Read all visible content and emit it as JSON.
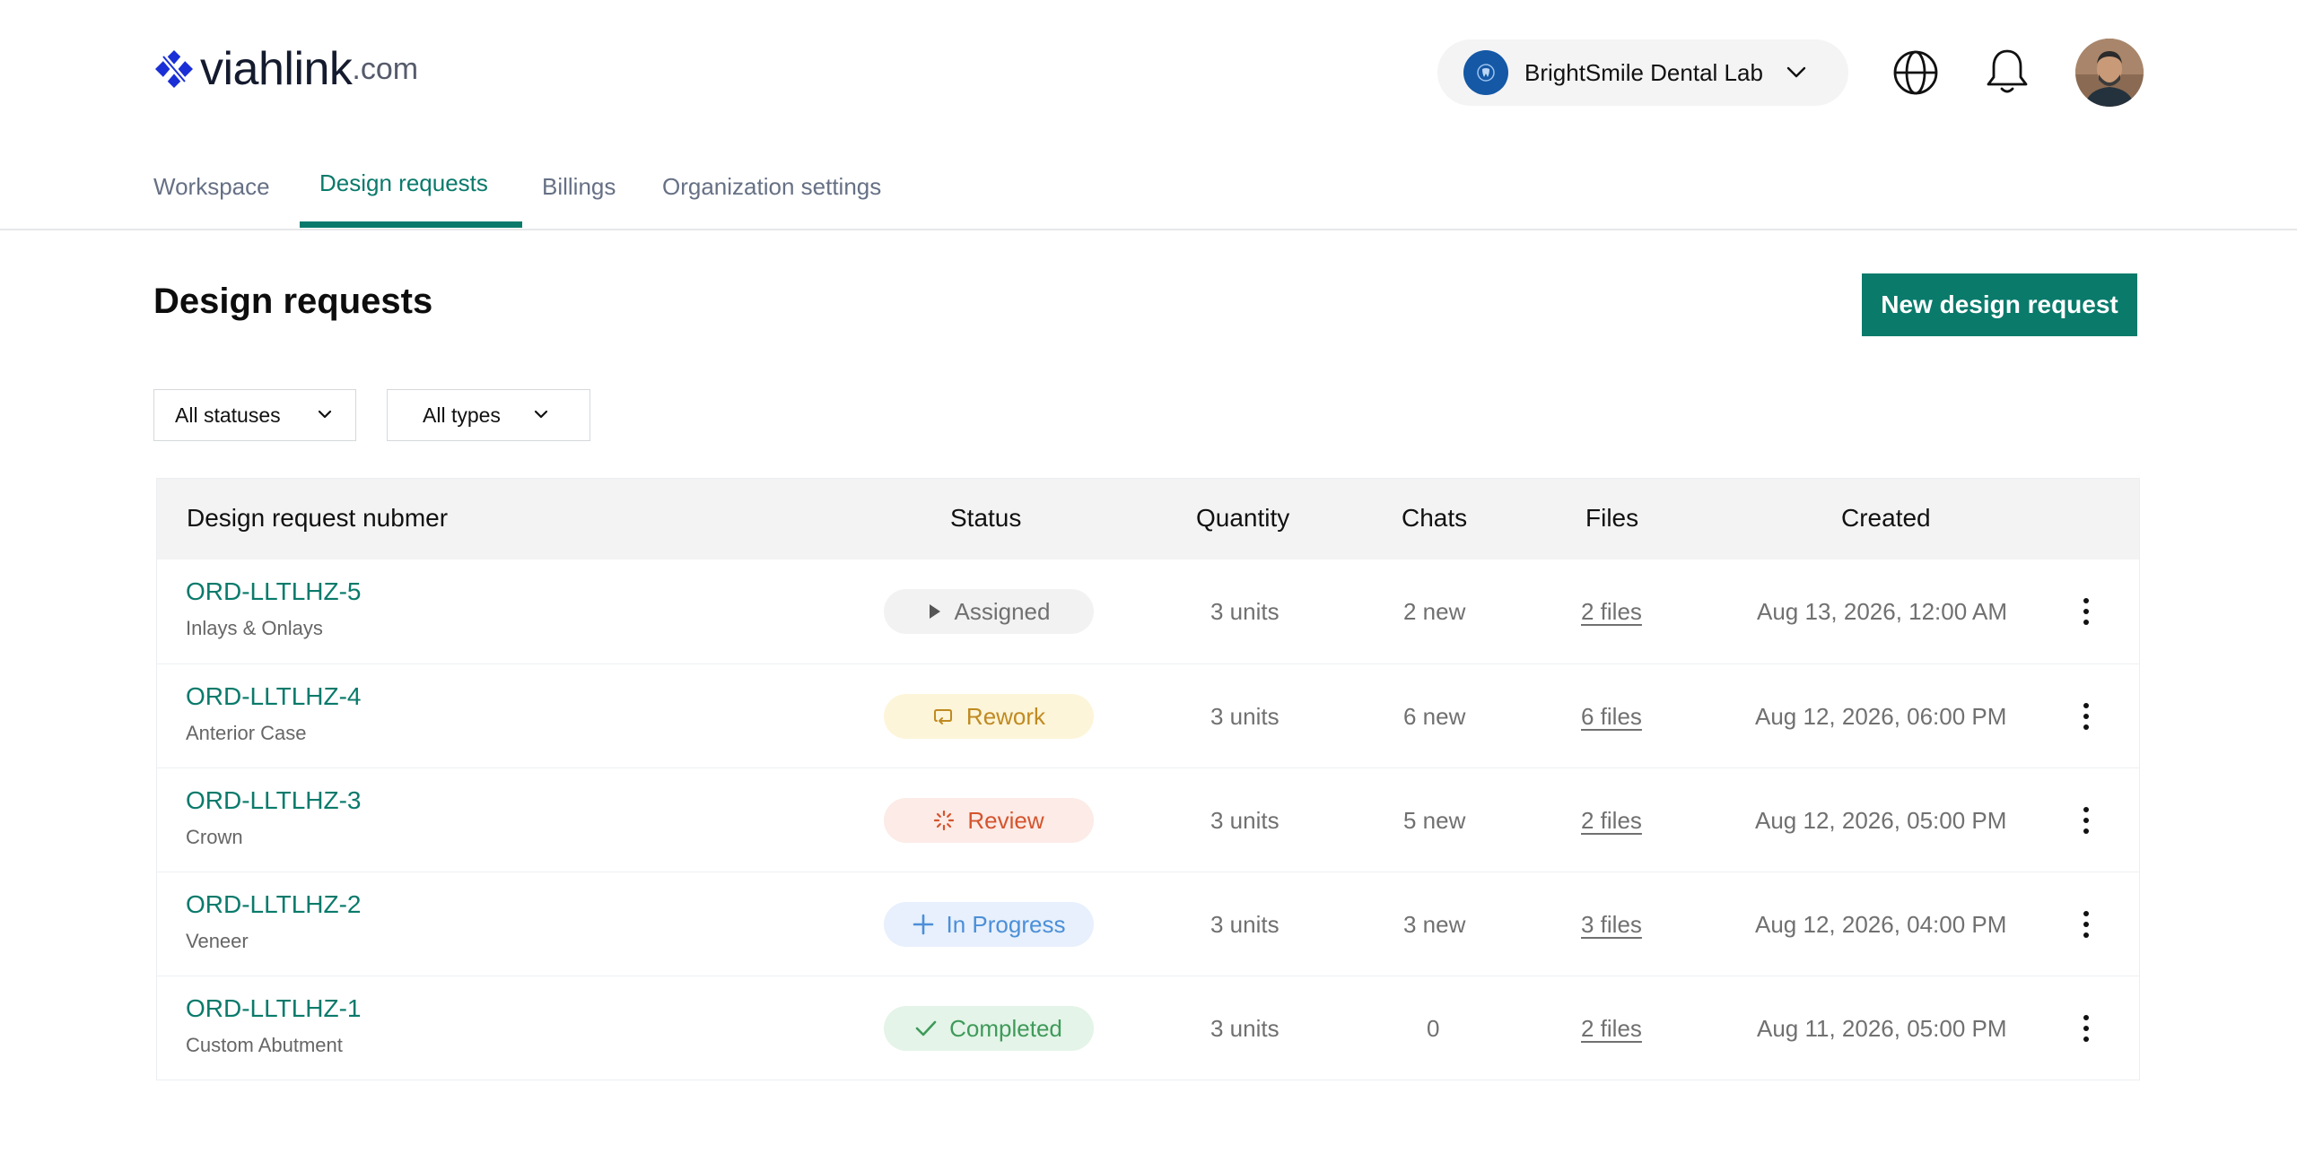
{
  "brand": {
    "name": "viahlink",
    "dot": ".",
    "suffix": "com"
  },
  "header": {
    "org_name": "BrightSmile Dental Lab"
  },
  "tabs": [
    {
      "label": "Workspace",
      "active": false
    },
    {
      "label": "Design requests",
      "active": true
    },
    {
      "label": "Billings",
      "active": false
    },
    {
      "label": "Organization settings",
      "active": false
    }
  ],
  "page": {
    "title": "Design requests",
    "new_button": "New design request"
  },
  "filters": {
    "status": "All statuses",
    "type": "All types"
  },
  "table": {
    "columns": {
      "number": "Design request nubmer",
      "status": "Status",
      "quantity": "Quantity",
      "chats": "Chats",
      "files": "Files",
      "created": "Created"
    },
    "rows": [
      {
        "id": "ORD-LLTLHZ-5",
        "type": "Inlays & Onlays",
        "status": "Assigned",
        "quantity": "3 units",
        "chats": "2 new",
        "files": "2 files",
        "created": "Aug 13, 2026, 12:00 AM"
      },
      {
        "id": "ORD-LLTLHZ-4",
        "type": "Anterior Case",
        "status": "Rework",
        "quantity": "3 units",
        "chats": "6 new",
        "files": "6 files",
        "created": "Aug 12, 2026, 06:00 PM"
      },
      {
        "id": "ORD-LLTLHZ-3",
        "type": "Crown",
        "status": "Review",
        "quantity": "3 units",
        "chats": "5 new",
        "files": "2 files",
        "created": "Aug 12, 2026, 05:00 PM"
      },
      {
        "id": "ORD-LLTLHZ-2",
        "type": "Veneer",
        "status": "In Progress",
        "quantity": "3 units",
        "chats": "3 new",
        "files": "3 files",
        "created": "Aug 12, 2026, 04:00 PM"
      },
      {
        "id": "ORD-LLTLHZ-1",
        "type": "Custom Abutment",
        "status": "Completed",
        "quantity": "3 units",
        "chats": "0",
        "files": "2 files",
        "created": "Aug 11, 2026, 05:00 PM"
      }
    ]
  },
  "colors": {
    "accent": "#0a7a6b",
    "assigned_bg": "#f2f2f2",
    "assigned_fg": "#707070",
    "rework_bg": "#fdf5d9",
    "rework_fg": "#c08a22",
    "review_bg": "#fcebe6",
    "review_fg": "#d4542e",
    "progress_bg": "#e7f0fc",
    "progress_fg": "#4c8fd8",
    "completed_bg": "#e4f4e8",
    "completed_fg": "#3f9a5a"
  },
  "icons": {
    "assigned": "play-icon",
    "rework": "repeat-icon",
    "review": "spinner-icon",
    "in_progress": "plus-icon",
    "completed": "check-icon"
  }
}
